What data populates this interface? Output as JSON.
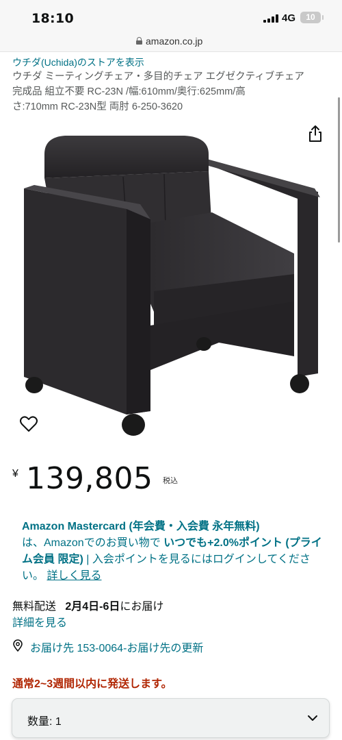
{
  "status_bar": {
    "time": "18:10",
    "network": "4G",
    "battery": "10"
  },
  "browser": {
    "url": "amazon.co.jp"
  },
  "product": {
    "store_link": "ウチダ(Uchida)のストアを表示",
    "title_lines": [
      "ウチダ ミーティングチェア・多目的チェア エグゼクティブチェア",
      "完成品 組立不要 RC-23N /幅:610mm/奥行:625mm/高",
      "さ:710mm RC-23N型 両肘 6-250-3620"
    ],
    "image_alt": "ウチダ ミーティングチェア"
  },
  "price": {
    "symbol": "¥",
    "value": "139,805",
    "tax": "税込"
  },
  "promo": {
    "card_name": "Amazon Mastercard (年会費・入会費 永年無料)",
    "text_1": "は、Amazonでのお買い物で ",
    "bold_points": "いつでも+2.0%ポイント (プライム会員 限定)",
    "text_2": " | 入会ポイントを見るにはログインしてください。",
    "more_link": "詳しく見る"
  },
  "delivery": {
    "label": "無料配送",
    "dates": "2月4日-6日",
    "suffix": "にお届け",
    "details_link": "詳細を見る",
    "location": "お届け先 153-0064-お届け先の更新"
  },
  "ship_notice": "通常2~3週間以内に発送します。",
  "quantity": {
    "label": "数量: 1"
  },
  "icons": {
    "share": "share-icon",
    "wishlist": "heart-icon",
    "location": "pin-icon",
    "dropdown": "chevron-down-icon",
    "lock": "lock-icon"
  },
  "colors": {
    "link": "#007185",
    "alert": "#b12704",
    "text": "#0f1111"
  }
}
